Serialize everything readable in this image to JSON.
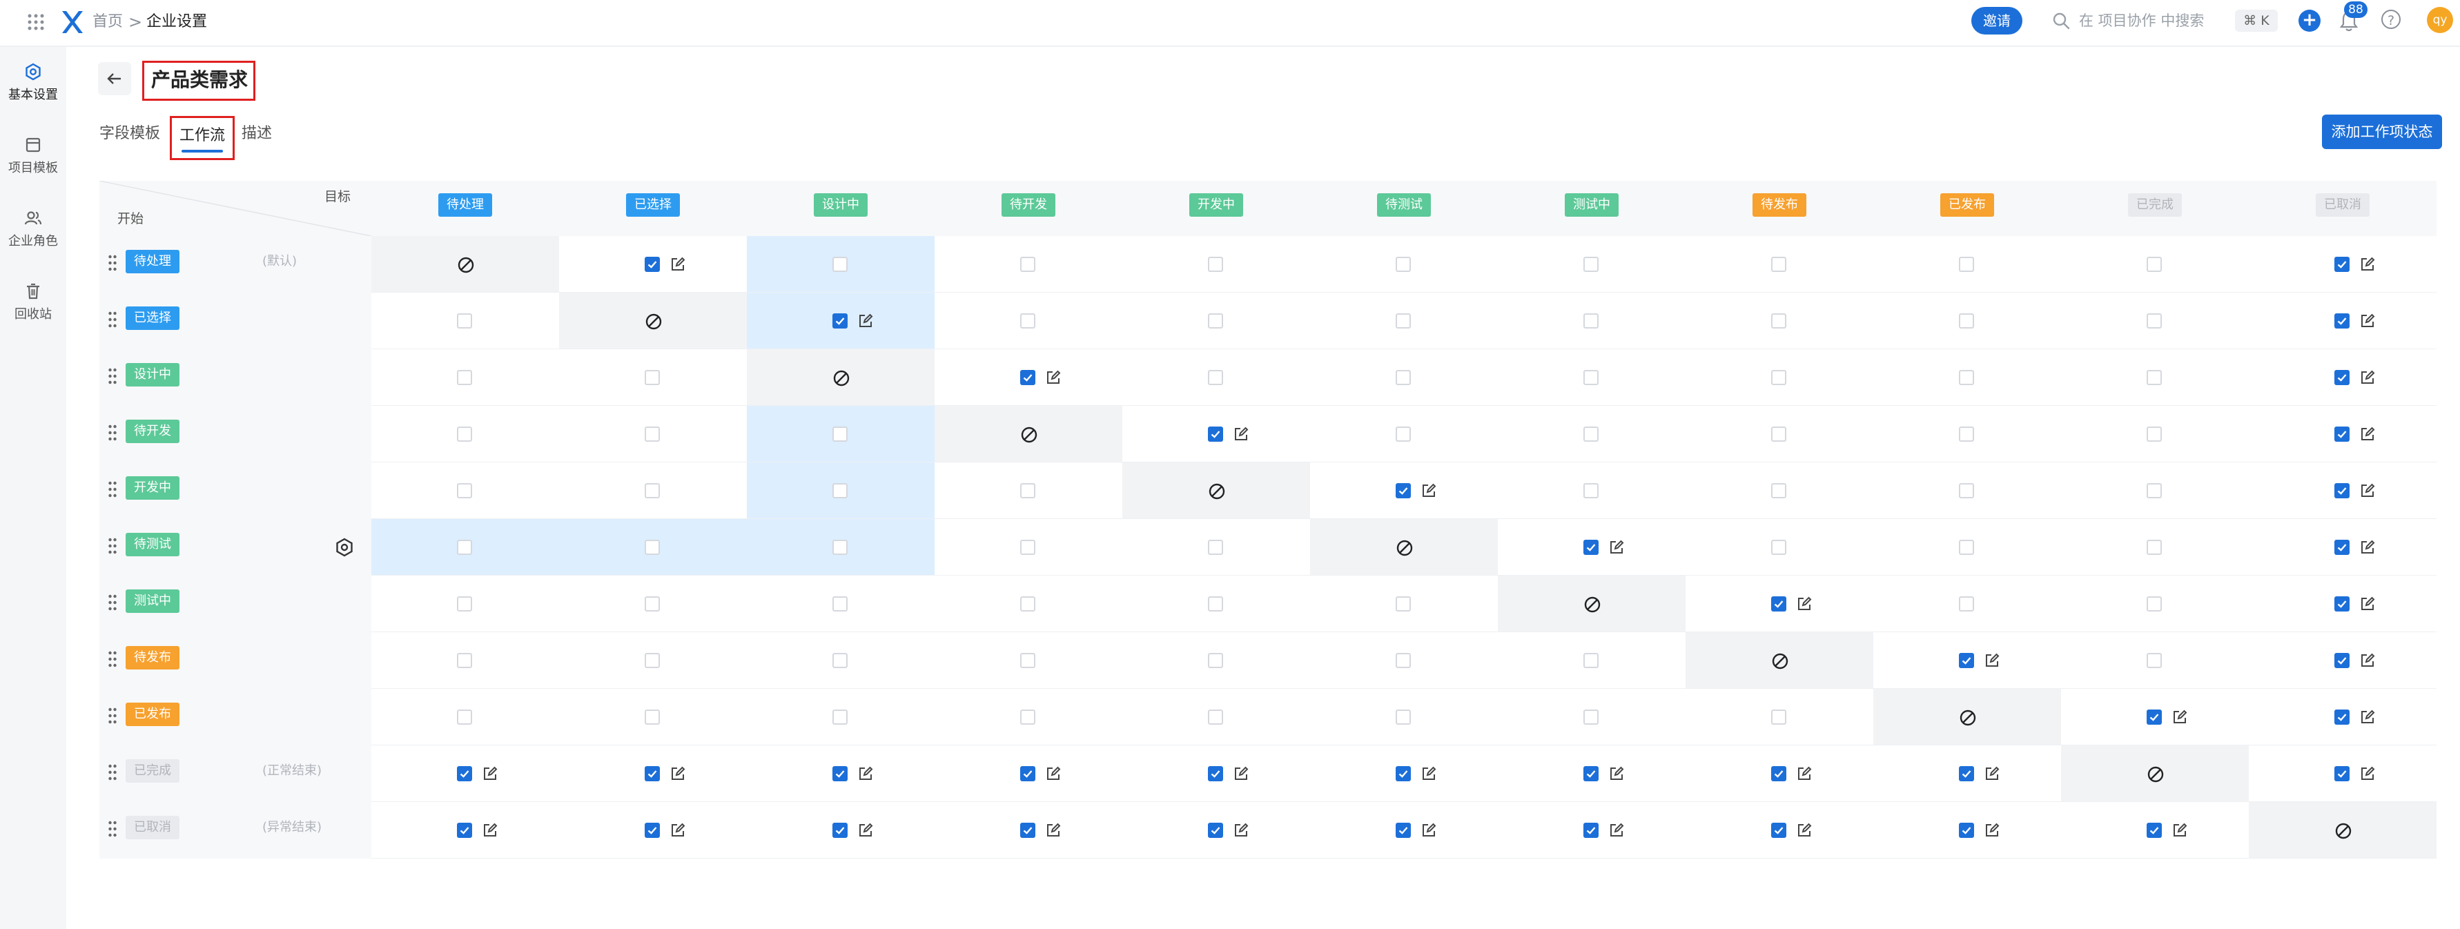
{
  "topbar": {
    "breadcrumb_home": "首页",
    "breadcrumb_sep": ">",
    "breadcrumb_current": "企业设置",
    "invite_label": "邀请",
    "search_placeholder": "在 项目协作 中搜索",
    "shortcut": "⌘ K",
    "add_label": "+",
    "notification_count": "88",
    "help_label": "?",
    "avatar_initials": "qy",
    "icons": [
      "apps-grid-icon",
      "app-logo-icon",
      "search-icon",
      "bell-icon",
      "help-icon"
    ]
  },
  "sidebar": {
    "items": [
      {
        "label": "基本设置",
        "icon": "settings-hexagon-icon",
        "active": true
      },
      {
        "label": "项目模板",
        "icon": "template-icon",
        "active": false
      },
      {
        "label": "企业角色",
        "icon": "users-icon",
        "active": false
      },
      {
        "label": "回收站",
        "icon": "trash-icon",
        "active": false
      }
    ]
  },
  "page": {
    "title": "产品类需求",
    "tabs": [
      "字段模板",
      "工作流",
      "描述"
    ],
    "active_tab": "工作流",
    "add_status_label": "添加工作项状态"
  },
  "matrix": {
    "corner_target": "目标",
    "corner_start": "开始",
    "states": [
      {
        "name": "待处理",
        "color": "#2d9cf0",
        "note": "(默认)"
      },
      {
        "name": "已选择",
        "color": "#2d9cf0",
        "note": ""
      },
      {
        "name": "设计中",
        "color": "#5cc998",
        "note": ""
      },
      {
        "name": "待开发",
        "color": "#5cc998",
        "note": ""
      },
      {
        "name": "开发中",
        "color": "#5cc998",
        "note": ""
      },
      {
        "name": "待测试",
        "color": "#5cc998",
        "note": ""
      },
      {
        "name": "测试中",
        "color": "#5cc998",
        "note": ""
      },
      {
        "name": "待发布",
        "color": "#f7a12f",
        "note": ""
      },
      {
        "name": "已发布",
        "color": "#f7a12f",
        "note": ""
      },
      {
        "name": "已完成",
        "color": "#e9eaee",
        "note": "(正常结束)"
      },
      {
        "name": "已取消",
        "color": "#e9eaee",
        "note": "(异常结束)"
      }
    ],
    "highlighted_row": 5,
    "highlighted_col": 2,
    "transitions": [
      [
        -1,
        1,
        0,
        0,
        0,
        0,
        0,
        0,
        0,
        0,
        1
      ],
      [
        0,
        -1,
        1,
        0,
        0,
        0,
        0,
        0,
        0,
        0,
        1
      ],
      [
        0,
        0,
        -1,
        1,
        0,
        0,
        0,
        0,
        0,
        0,
        1
      ],
      [
        0,
        0,
        0,
        -1,
        1,
        0,
        0,
        0,
        0,
        0,
        1
      ],
      [
        0,
        0,
        0,
        0,
        -1,
        1,
        0,
        0,
        0,
        0,
        1
      ],
      [
        0,
        0,
        0,
        0,
        0,
        -1,
        1,
        0,
        0,
        0,
        1
      ],
      [
        0,
        0,
        0,
        0,
        0,
        0,
        -1,
        1,
        0,
        0,
        1
      ],
      [
        0,
        0,
        0,
        0,
        0,
        0,
        0,
        -1,
        1,
        0,
        1
      ],
      [
        0,
        0,
        0,
        0,
        0,
        0,
        0,
        0,
        -1,
        1,
        1
      ],
      [
        1,
        1,
        1,
        1,
        1,
        1,
        1,
        1,
        1,
        -1,
        1
      ],
      [
        1,
        1,
        1,
        1,
        1,
        1,
        1,
        1,
        1,
        1,
        -1
      ]
    ]
  }
}
